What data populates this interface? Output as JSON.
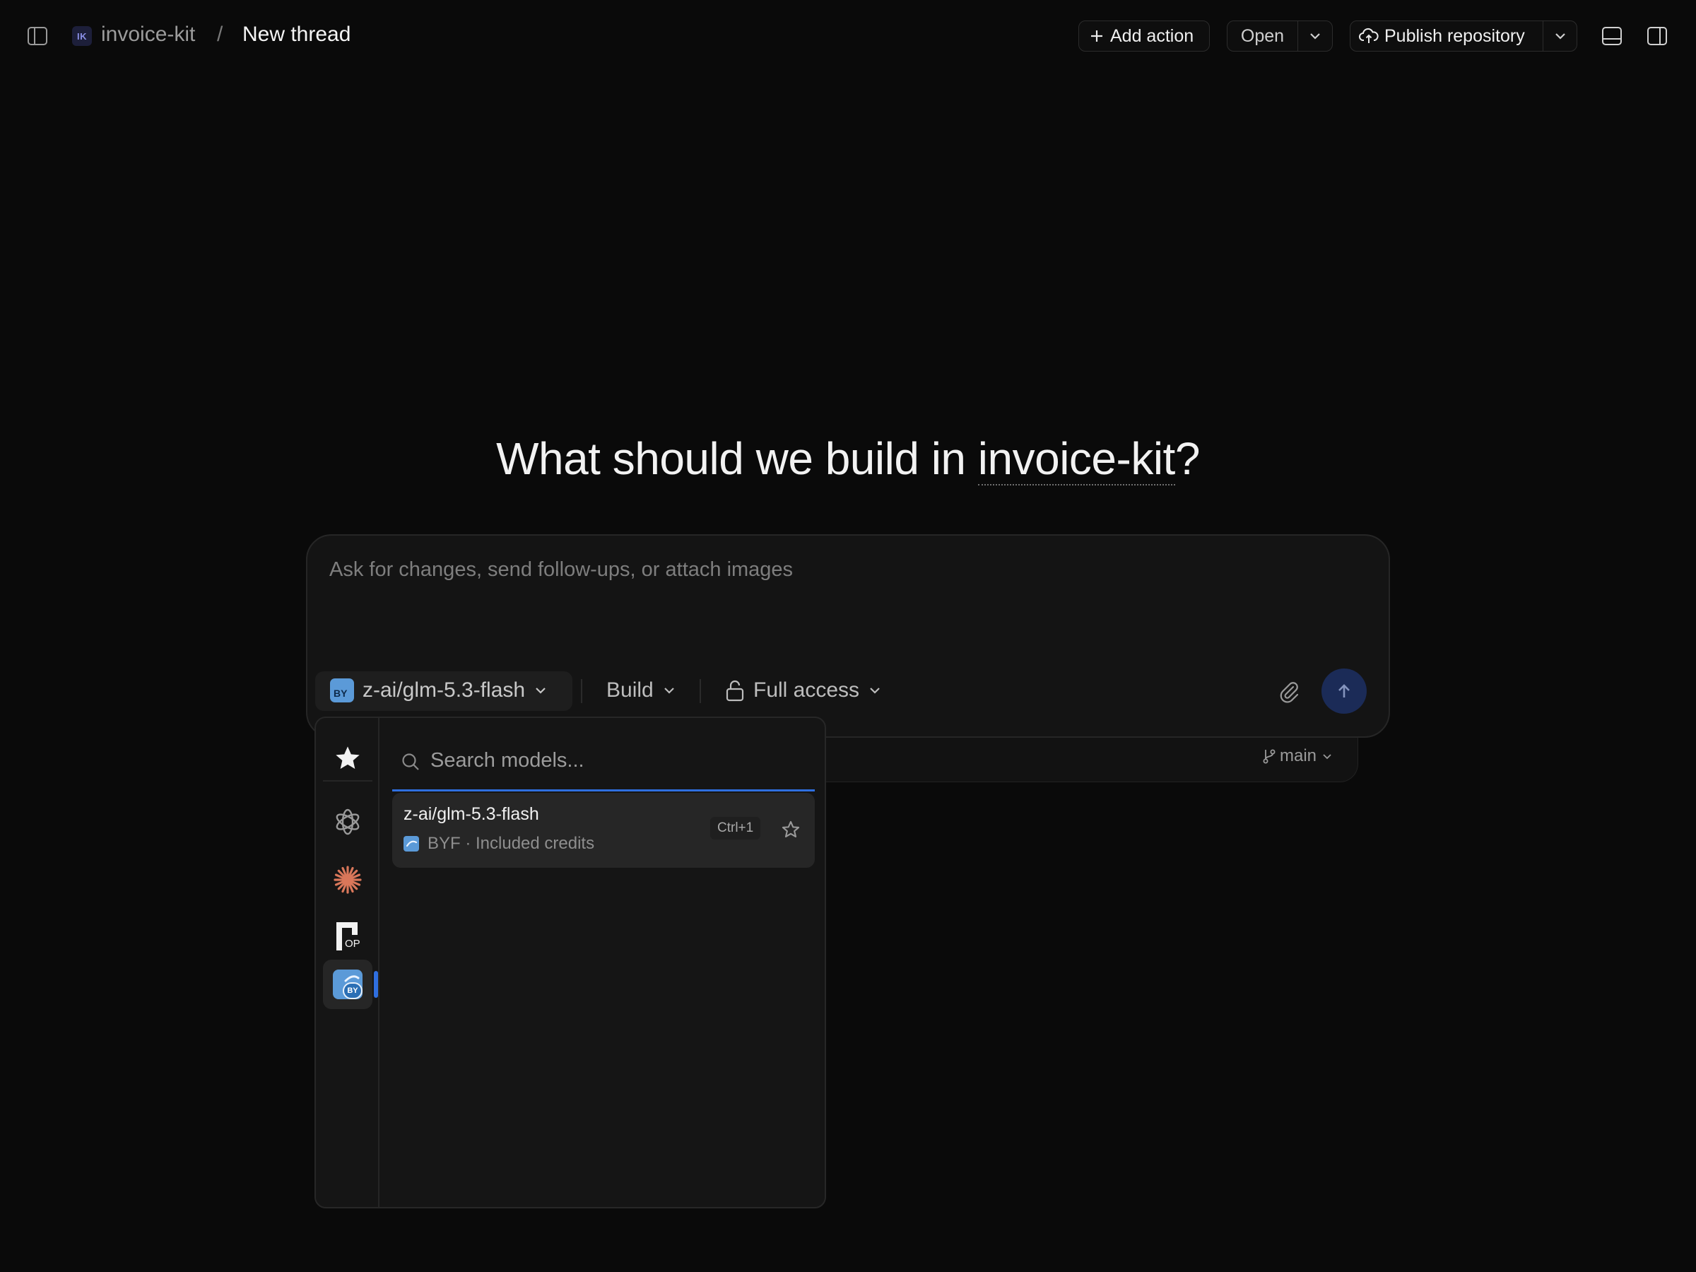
{
  "breadcrumb": {
    "project_badge": "IK",
    "project": "invoice-kit",
    "separator": "/",
    "thread": "New thread"
  },
  "toolbar": {
    "add_action": "Add action",
    "open": "Open",
    "publish": "Publish repository"
  },
  "hero": {
    "prefix": "What should we build in ",
    "project": "invoice-kit",
    "suffix": "?"
  },
  "composer": {
    "placeholder": "Ask for changes, send follow-ups, or attach images",
    "model": "z-ai/glm-5.3-flash",
    "model_badge": "BY",
    "mode": "Build",
    "access": "Full access",
    "branch": "main"
  },
  "model_menu": {
    "search_placeholder": "Search models...",
    "provider_tabs": [
      {
        "name": "favorites",
        "icon": "star-icon"
      },
      {
        "name": "openai",
        "icon": "openai-icon"
      },
      {
        "name": "anthropic",
        "icon": "anthropic-icon"
      },
      {
        "name": "openrouter",
        "icon": "op-icon",
        "label": "OP"
      },
      {
        "name": "byf",
        "icon": "byf-icon",
        "label": "BY",
        "active": true
      }
    ],
    "models": [
      {
        "name": "z-ai/glm-5.3-flash",
        "provider": "BYF · Included credits",
        "shortcut": "Ctrl+1"
      }
    ]
  },
  "colors": {
    "background": "#0a0a0a",
    "accent": "#2f6fe0",
    "send_button": "#1b2b57",
    "anthropic": "#d9775a",
    "byf": "#5b9ad8"
  }
}
